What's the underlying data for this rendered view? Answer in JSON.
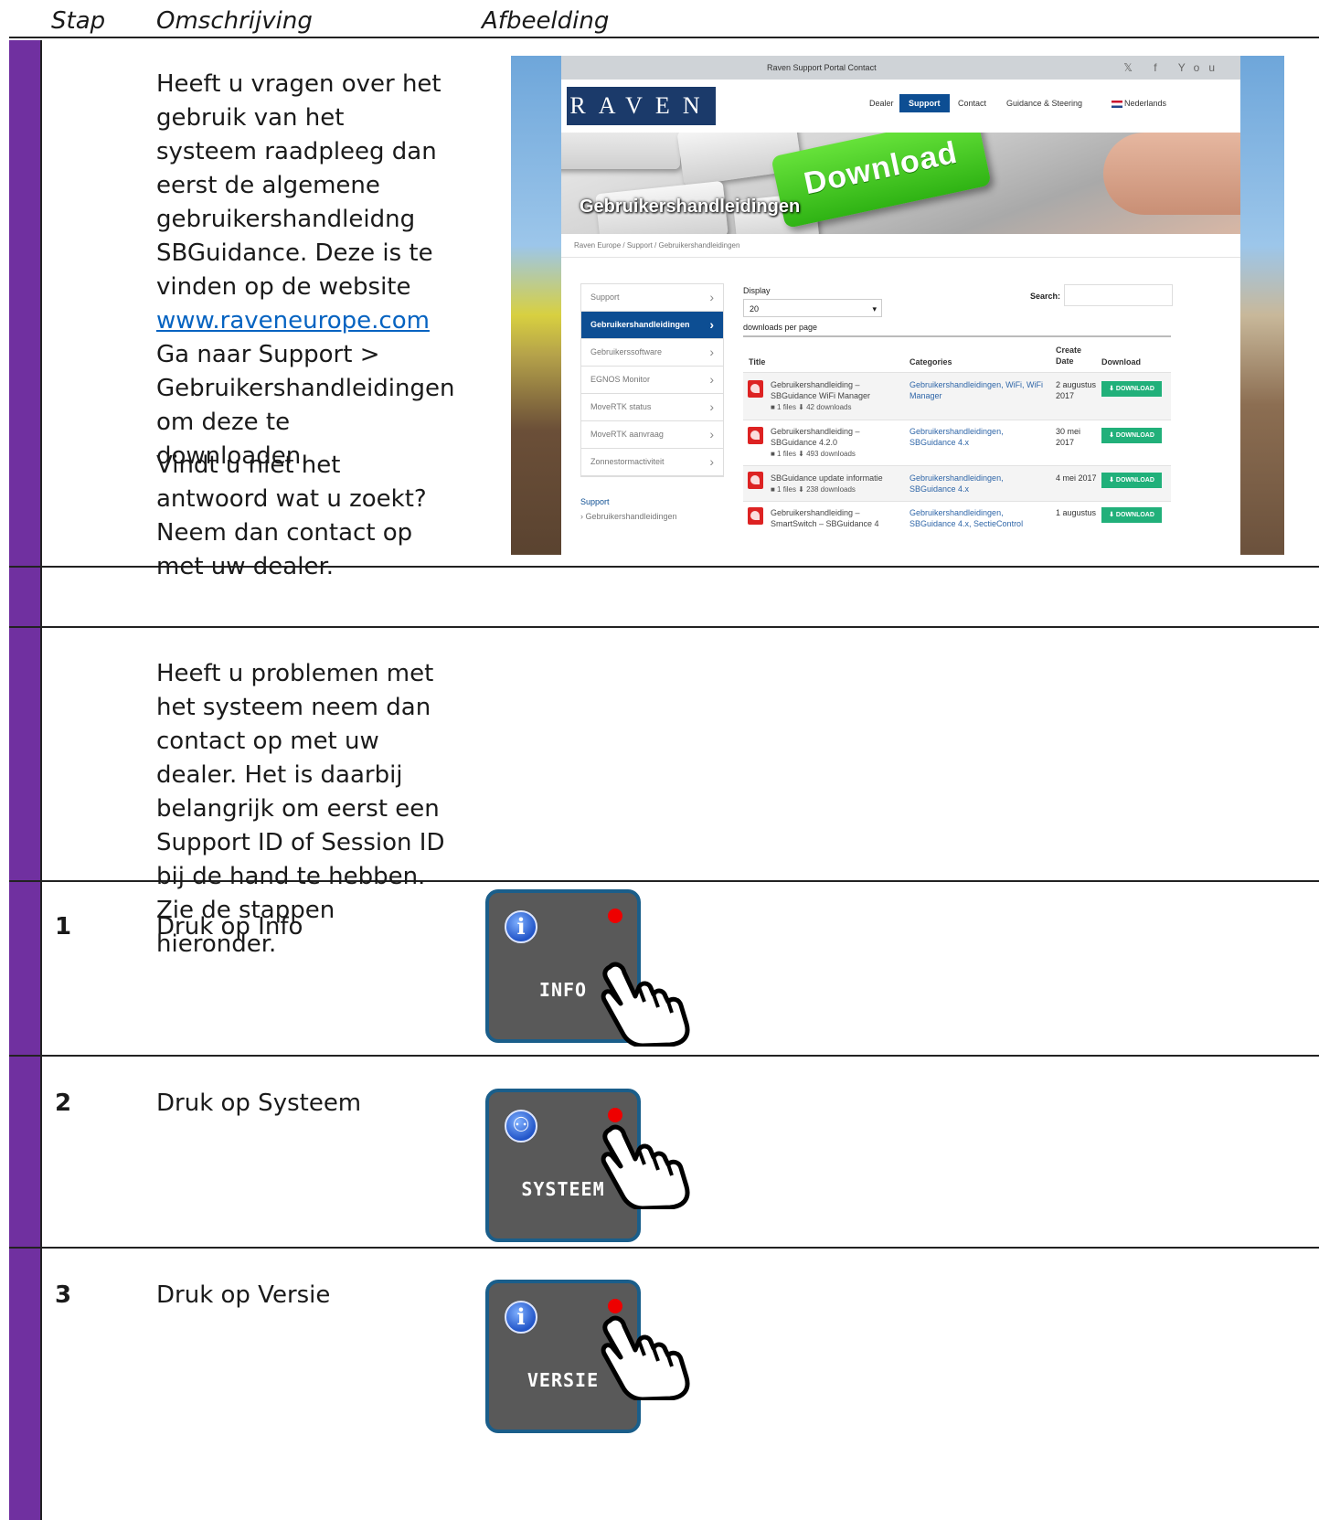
{
  "header": {
    "col_step": "Stap",
    "col_description": "Omschrijving",
    "col_image": "Afbeelding"
  },
  "intro": {
    "text_before_link": "Heeft u vragen over het gebruik van het systeem raadpleeg dan eerst de algemene gebruikershandleidng SBGuidance. Deze is te vinden op de website",
    "link": "www.raveneurope.com",
    "text_after_link": "Ga naar Support > Gebruikershandleidingen om deze te downloaden.",
    "text_second": "Vindt u niet het antwoord wat u zoekt? Neem dan contact op met uw dealer."
  },
  "problems_text": "Heeft u problemen met het systeem neem dan contact op met uw dealer. Het is daarbij belangrijk om eerst een Support ID of Session ID bij de hand te hebben. Zie de stappen hieronder.",
  "steps": [
    {
      "number": "1",
      "description": "Druk op Info",
      "button_label": "INFO",
      "icon": "info-icon"
    },
    {
      "number": "2",
      "description": "Druk op Systeem",
      "button_label": "SYSTEEM",
      "icon": "accessibility-icon"
    },
    {
      "number": "3",
      "description": "Druk op Versie",
      "button_label": "VERSIE",
      "icon": "info-icon"
    }
  ],
  "website": {
    "topbar_links": "Raven Support Portal    Contact",
    "social": "𝕏 f You",
    "logo": "RAVEN",
    "nav": [
      "Dealer",
      "Support",
      "Contact",
      "Guidance & Steering",
      "Nederlands"
    ],
    "banner_key": "Download",
    "banner_title": "Gebruikershandleidingen",
    "breadcrumb": "Raven Europe / Support / Gebruikershandleidingen",
    "menu": [
      "Support",
      "Gebruikershandleidingen",
      "Gebruikerssoftware",
      "EGNOS Monitor",
      "MoveRTK status",
      "MoveRTK aanvraag",
      "Zonnestormactiviteit"
    ],
    "side_heading": "Support",
    "side_sub": "› Gebruikershandleidingen",
    "display_label": "Display",
    "display_value": "20",
    "per_page": "downloads per page",
    "search_label": "Search:",
    "columns": {
      "title": "Title",
      "categories": "Categories",
      "create_date": "Create Date",
      "download": "Download"
    },
    "rows": [
      {
        "title": "Gebruikershandleiding – SBGuidance WiFi Manager",
        "meta": "■  1 files   ⬇  42 downloads",
        "categories": "Gebruikershandleidingen, WiFi, WiFi Manager",
        "date": "2 augustus 2017"
      },
      {
        "title": "Gebruikershandleiding – SBGuidance 4.2.0",
        "meta": "■  1 files   ⬇  493 downloads",
        "categories": "Gebruikershandleidingen, SBGuidance 4.x",
        "date": "30 mei 2017"
      },
      {
        "title": "SBGuidance update informatie",
        "meta": "■  1 files   ⬇  238 downloads",
        "categories": "Gebruikershandleidingen, SBGuidance 4.x",
        "date": "4 mei 2017"
      },
      {
        "title": "Gebruikershandleiding – SmartSwitch – SBGuidance 4",
        "meta": "",
        "categories": "Gebruikershandleidingen, SBGuidance 4.x, SectieControl",
        "date": "1 augustus"
      }
    ],
    "download_label": "⬇ DOWNLOAD"
  }
}
